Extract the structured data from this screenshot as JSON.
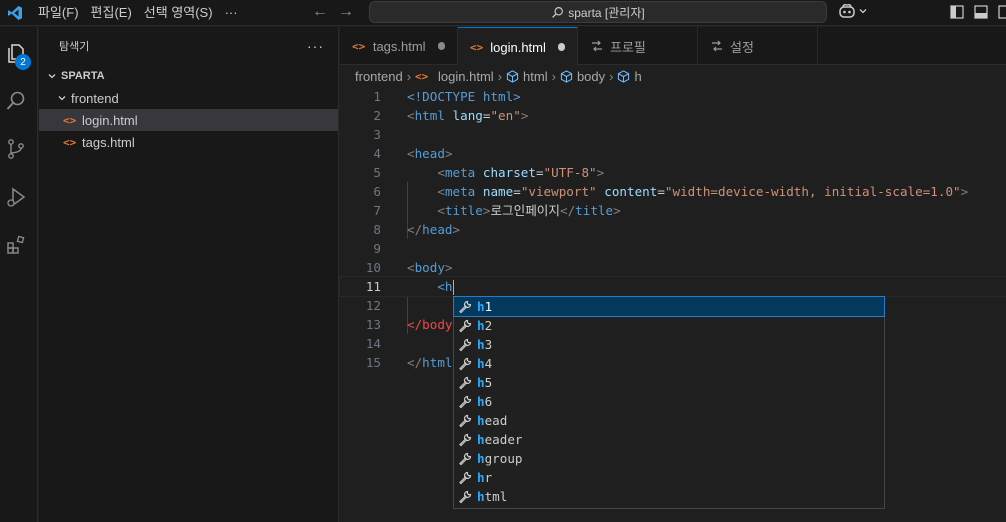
{
  "titlebar": {
    "menu": [
      "파일(F)",
      "편집(E)",
      "선택 영역(S)",
      "···"
    ],
    "search_text": "sparta [관리자]"
  },
  "activitybar": {
    "explorer_badge": "2"
  },
  "sidebar": {
    "title": "탐색기",
    "more": "···",
    "section": "SPARTA",
    "folder": "frontend",
    "files": [
      "login.html",
      "tags.html"
    ]
  },
  "tabs": [
    {
      "label": "tags.html",
      "icon": "html-icon",
      "dirty": true,
      "active": false
    },
    {
      "label": "login.html",
      "icon": "html-icon",
      "dirty": true,
      "active": true
    },
    {
      "label": "프로필",
      "icon": "settings-sync-icon",
      "dirty": false,
      "active": false
    },
    {
      "label": "설정",
      "icon": "settings-sync-icon",
      "dirty": false,
      "active": false
    }
  ],
  "breadcrumb": [
    "frontend",
    "login.html",
    "html",
    "body",
    "h"
  ],
  "code": {
    "line_numbers": [
      "1",
      "2",
      "3",
      "4",
      "5",
      "6",
      "7",
      "8",
      "9",
      "10",
      "11",
      "12",
      "13",
      "14",
      "15"
    ],
    "current_line": 11,
    "title_text": "로그인페이지",
    "doctype": "<!DOCTYPE html>",
    "lang_value": "\"en\"",
    "charset_value": "\"UTF-8\"",
    "viewport_value": "\"viewport\"",
    "content_value": "\"width=device-width, initial-scale=1.0\"",
    "typed": "<h"
  },
  "suggestions": {
    "query": "h",
    "items": [
      "h1",
      "h2",
      "h3",
      "h4",
      "h5",
      "h6",
      "head",
      "header",
      "hgroup",
      "hr",
      "html"
    ],
    "selected_index": 0
  },
  "colors": {
    "accent": "#0078d4",
    "tag": "#569cd6",
    "attr": "#9cdcfe",
    "string": "#ce9178",
    "error_tag": "#f44747",
    "match": "#2aaaff"
  }
}
